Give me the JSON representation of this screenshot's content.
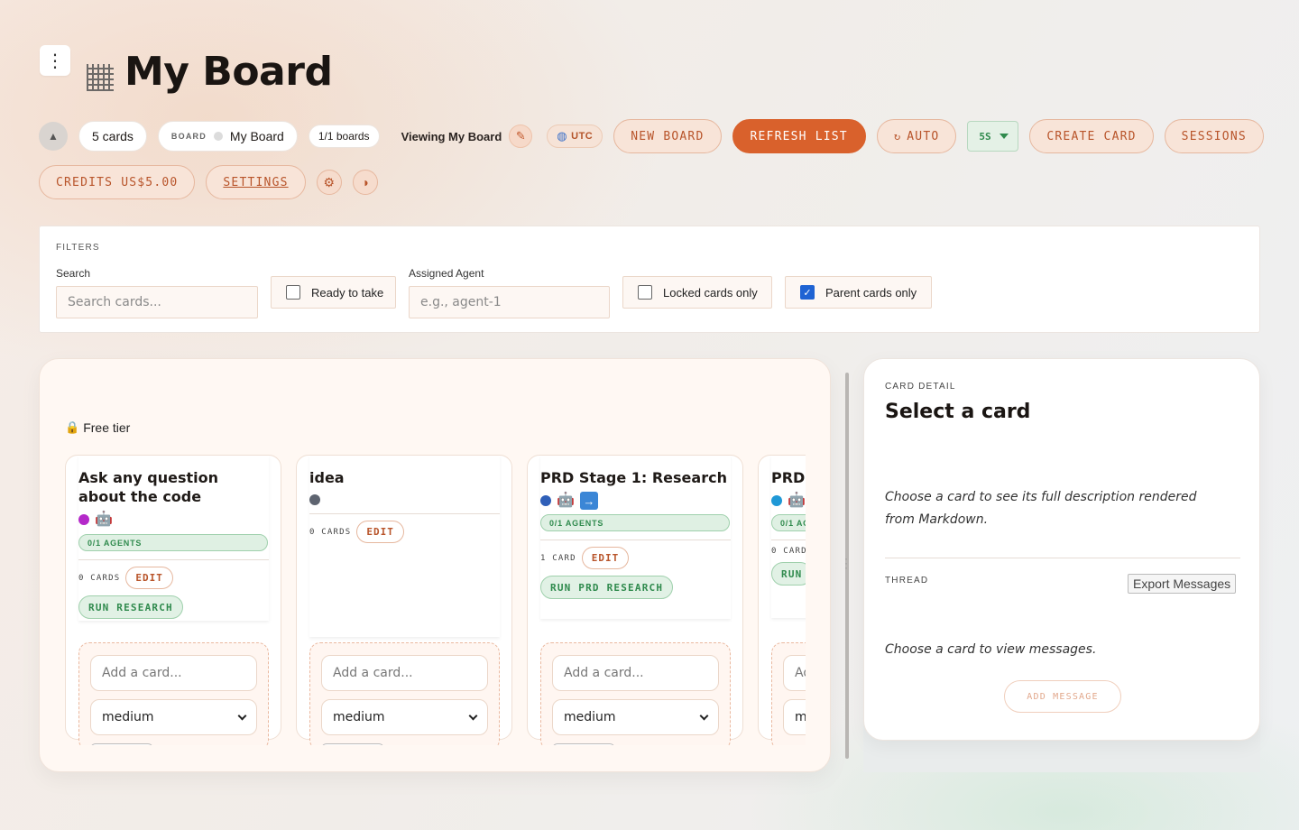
{
  "header": {
    "title": "My Board",
    "menu_icon": "⋮"
  },
  "toolbar": {
    "cards_count": "5 cards",
    "board_label": "BOARD",
    "board_name": "My Board",
    "boards_count": "1/1 boards",
    "viewing": "Viewing My Board",
    "timezone": "UTC",
    "new_board": "NEW BOARD",
    "refresh_list": "REFRESH LIST",
    "auto": "AUTO",
    "interval": "5S",
    "create_card": "CREATE CARD",
    "sessions": "SESSIONS",
    "credits": "CREDITS US$5.00",
    "settings": "SETTINGS"
  },
  "filters": {
    "title": "FILTERS",
    "search_label": "Search",
    "search_placeholder": "Search cards...",
    "ready_to_take": "Ready to take",
    "assigned_agent_label": "Assigned Agent",
    "assigned_agent_placeholder": "e.g., agent-1",
    "locked_only": "Locked cards only",
    "parent_only": "Parent cards only",
    "ready_checked": false,
    "locked_checked": false,
    "parent_checked": true
  },
  "board": {
    "tier": "Free tier",
    "columns": [
      {
        "title": "Ask any question about the code",
        "dot_color": "#b429c9",
        "agents": "0/1 AGENTS",
        "count": "0 CARDS",
        "edit": "EDIT",
        "action": "RUN RESEARCH",
        "add_placeholder": "Add a card...",
        "priority": "medium"
      },
      {
        "title": "idea",
        "dot_color": "#5e6470",
        "count": "0 CARDS",
        "edit": "EDIT",
        "add_placeholder": "Add a card...",
        "priority": "medium"
      },
      {
        "title": "PRD Stage 1: Research",
        "dot_color": "#2f5fb8",
        "agents": "0/1 AGENTS",
        "count": "1 CARD",
        "edit": "EDIT",
        "action": "RUN PRD RESEARCH",
        "add_placeholder": "Add a card...",
        "priority": "medium"
      },
      {
        "title": "PRD S",
        "dot_color": "#1f98d6",
        "agents": "0/1 AG",
        "count": "0 CARD",
        "action": "RUN",
        "add_placeholder": "Ad",
        "priority": "m"
      }
    ]
  },
  "detail": {
    "label": "CARD DETAIL",
    "title": "Select a card",
    "description": "Choose a card to see its full description rendered from Markdown.",
    "thread_label": "THREAD",
    "export": "Export Messages",
    "thread_empty": "Choose a card to view messages.",
    "add_message": "ADD MESSAGE"
  }
}
